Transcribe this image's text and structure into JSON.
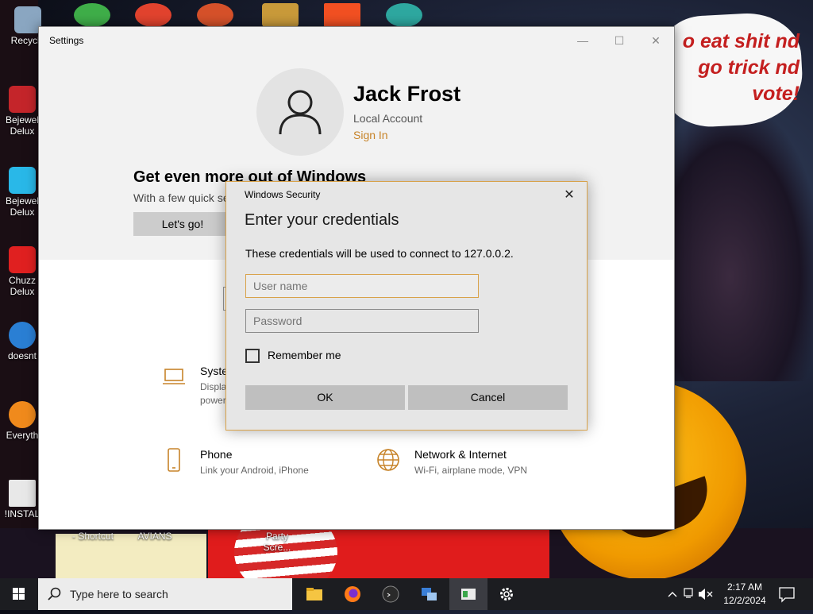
{
  "desktop": {
    "icons": [
      {
        "label": "Recycle",
        "color": "#8aa6c1"
      },
      {
        "label": "Bejewel Delux",
        "color": "#c4252a"
      },
      {
        "label": "Bejewel Delux",
        "color": "#29b8e8"
      },
      {
        "label": "Chuzz Delux",
        "color": "#e02020"
      },
      {
        "label": "doesnt",
        "color": "#2a7fd4"
      },
      {
        "label": "Everyth",
        "color": "#f08a1c"
      },
      {
        "label": "!INSTAL",
        "color": "#e8e8e8"
      }
    ],
    "bottom_labels": [
      "- Shortcut",
      "AVIANS",
      "Party Scre..."
    ],
    "wallpaper_text": "o eat shit nd go trick nd vote!"
  },
  "settings_window": {
    "title": "Settings",
    "controls": {
      "minimize": "—",
      "maximize": "☐",
      "close": "✕"
    },
    "account": {
      "name": "Jack Frost",
      "type": "Local Account",
      "sign_in": "Sign In"
    },
    "promo": {
      "title": "Get even more out of Windows",
      "subtitle": "With a few quick se",
      "button": "Let's go!"
    },
    "categories": [
      {
        "title": "Syste",
        "desc_line1": "Displa",
        "desc_line2": "power",
        "icon": "laptop-icon"
      },
      {
        "title": "Phone",
        "desc_line1": "Link your Android, iPhone",
        "icon": "phone-icon"
      },
      {
        "title": "Network & Internet",
        "desc_line1": "Wi-Fi, airplane mode, VPN",
        "icon": "globe-icon"
      }
    ]
  },
  "credential_dialog": {
    "caption": "Windows Security",
    "close": "✕",
    "heading": "Enter your credentials",
    "message": "These credentials will be used to connect to 127.0.0.2.",
    "username_placeholder": "User name",
    "password_placeholder": "Password",
    "remember_label": "Remember me",
    "remember_checked": false,
    "ok_label": "OK",
    "cancel_label": "Cancel",
    "accent_color": "#d8a24a"
  },
  "taskbar": {
    "search_placeholder": "Type here to search",
    "apps": [
      "file-explorer",
      "firefox",
      "terminal",
      "network-app",
      "settings-window",
      "settings-gear"
    ],
    "clock_time": "2:17 AM",
    "clock_date": "12/2/2024"
  }
}
